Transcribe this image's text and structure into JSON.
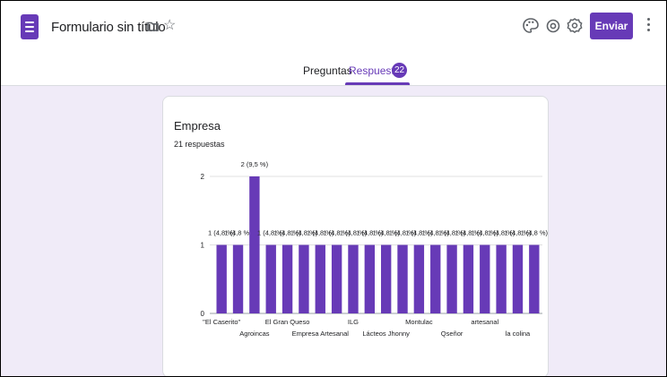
{
  "header": {
    "title": "Formulario sin título",
    "send_label": "Enviar",
    "icons": [
      "palette-icon",
      "preview-icon",
      "settings-icon"
    ]
  },
  "tabs": [
    {
      "label": "Preguntas",
      "active": false
    },
    {
      "label": "Respuestas",
      "active": true,
      "badge": "22"
    }
  ],
  "colors": {
    "accent": "#673ab7",
    "background": "#f0ebf8"
  },
  "question": {
    "title": "Empresa",
    "responses": "21 respuestas"
  },
  "chart_data": {
    "type": "bar",
    "categories": [
      "\"El Caserito\"",
      "",
      "Agroincas",
      "",
      "El Gran Queso",
      "",
      "Empresa Artesanal",
      "",
      "ILG",
      "",
      "Lácteos Jhonny",
      "",
      "Montulac",
      "",
      "Qseñor",
      "",
      "artesanal",
      "",
      "la colina",
      ""
    ],
    "values": [
      1,
      1,
      2,
      1,
      1,
      1,
      1,
      1,
      1,
      1,
      1,
      1,
      1,
      1,
      1,
      1,
      1,
      1,
      1,
      1
    ],
    "data_labels": [
      "1 (4,8 %)",
      "1 (4,8 %)",
      "2 (9,5 %)",
      "1 (4,8 %)",
      "1 (4,8 %)",
      "1 (4,8 %)",
      "1 (4,8 %)",
      "1 (4,8 %)",
      "1 (4,8 %)",
      "1 (4,8 %)",
      "1 (4,8 %)",
      "1 (4,8 %)",
      "1 (4,8 %)",
      "1 (4,8 %)",
      "1 (4,8 %)",
      "1 (4,8 %)",
      "1 (4,8 %)",
      "1 (4,8 %)",
      "1 (4,8 %)",
      "1 (4,8 %)"
    ],
    "y_ticks": [
      "0",
      "1",
      "2"
    ],
    "ylim": [
      0,
      2
    ],
    "grid": true,
    "color": "#673ab7"
  }
}
